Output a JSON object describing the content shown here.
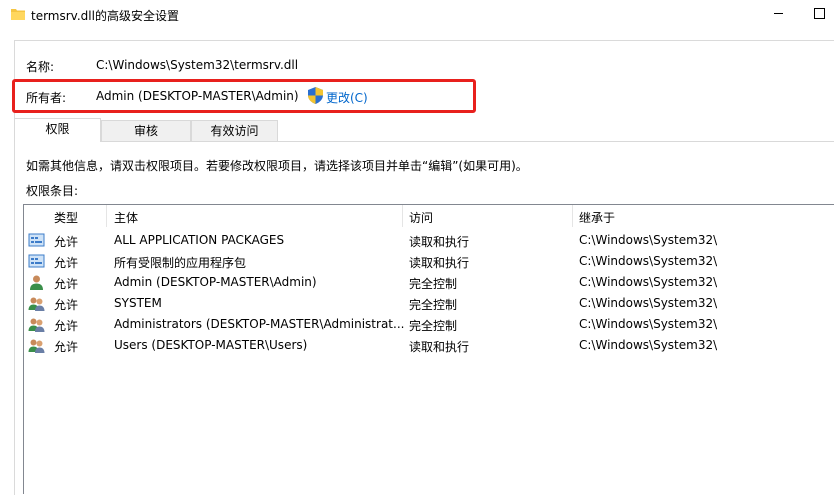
{
  "window": {
    "title": "termsrv.dll的高级安全设置"
  },
  "info": {
    "name_label": "名称:",
    "name_value": "C:\\Windows\\System32\\termsrv.dll",
    "owner_label": "所有者:",
    "owner_value": "Admin (DESKTOP-MASTER\\Admin)",
    "change_link": "更改(C)"
  },
  "tabs": [
    {
      "label": "权限",
      "active": true
    },
    {
      "label": "审核",
      "active": false
    },
    {
      "label": "有效访问",
      "active": false
    }
  ],
  "instruction": "如需其他信息，请双击权限项目。若要修改权限项目，请选择该项目并单击“编辑”(如果可用)。",
  "entries_label": "权限条目:",
  "table": {
    "headers": [
      "类型",
      "主体",
      "访问",
      "继承于"
    ],
    "rows": [
      {
        "icon": "package-icon",
        "type": "允许",
        "principal": "ALL APPLICATION PACKAGES",
        "access": "读取和执行",
        "inherited": "C:\\Windows\\System32\\"
      },
      {
        "icon": "package-icon",
        "type": "允许",
        "principal": "所有受限制的应用程序包",
        "access": "读取和执行",
        "inherited": "C:\\Windows\\System32\\"
      },
      {
        "icon": "user-icon",
        "type": "允许",
        "principal": "Admin (DESKTOP-MASTER\\Admin)",
        "access": "完全控制",
        "inherited": "C:\\Windows\\System32\\"
      },
      {
        "icon": "group-icon",
        "type": "允许",
        "principal": "SYSTEM",
        "access": "完全控制",
        "inherited": "C:\\Windows\\System32\\"
      },
      {
        "icon": "group-icon",
        "type": "允许",
        "principal": "Administrators (DESKTOP-MASTER\\Administrat...",
        "access": "完全控制",
        "inherited": "C:\\Windows\\System32\\"
      },
      {
        "icon": "group-icon",
        "type": "允许",
        "principal": "Users (DESKTOP-MASTER\\Users)",
        "access": "读取和执行",
        "inherited": "C:\\Windows\\System32\\"
      }
    ]
  },
  "colors": {
    "highlight_border": "#e8201d",
    "link": "#0066cc",
    "folder": "#f5c542"
  }
}
